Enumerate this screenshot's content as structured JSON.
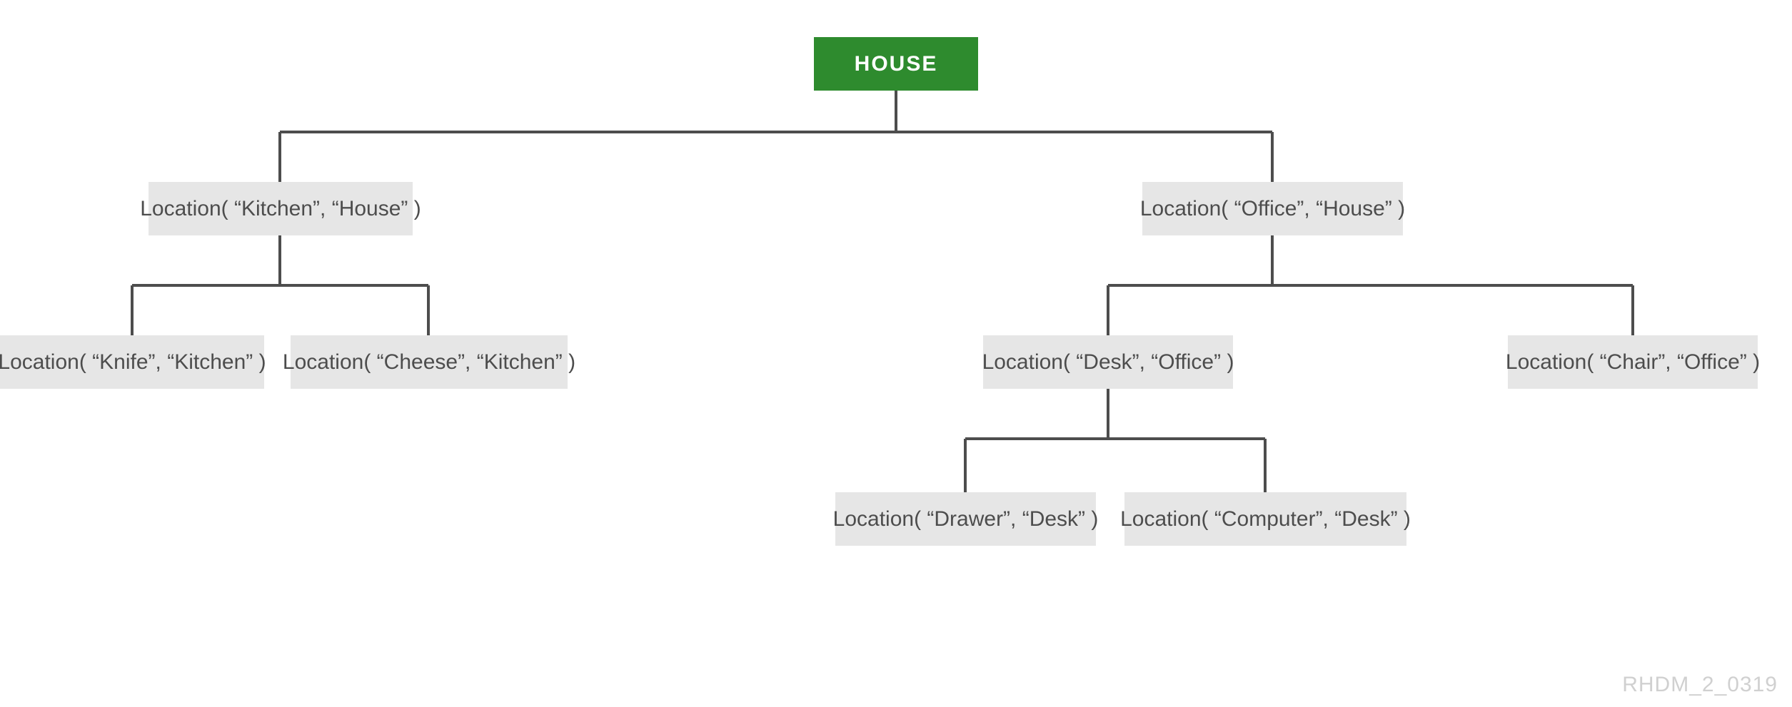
{
  "root": {
    "label": "HOUSE"
  },
  "level1": {
    "kitchen": "Location( “Kitchen”, “House” )",
    "office": "Location( “Office”, “House” )"
  },
  "level2": {
    "knife": "Location( “Knife”, “Kitchen” )",
    "cheese": "Location( “Cheese”, “Kitchen” )",
    "desk": "Location( “Desk”, “Office” )",
    "chair": "Location( “Chair”, “Office” )"
  },
  "level3": {
    "drawer": "Location( “Drawer”, “Desk” )",
    "computer": "Location( “Computer”, “Desk” )"
  },
  "watermark": "RHDM_2_0319"
}
